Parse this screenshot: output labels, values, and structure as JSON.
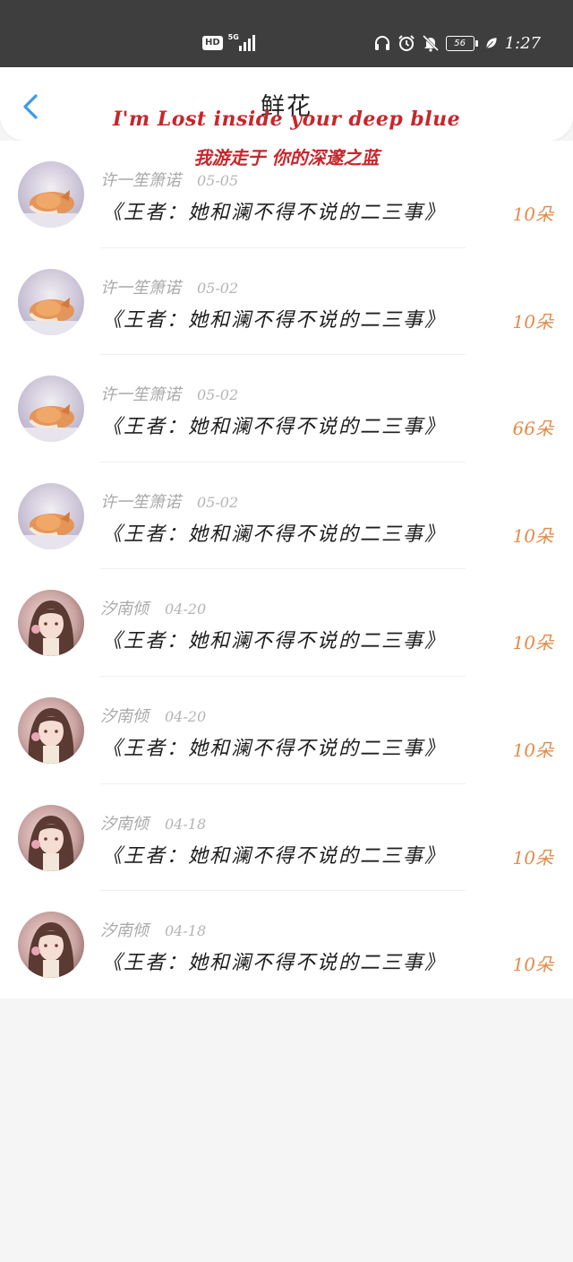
{
  "status_bar": {
    "hd_badge": "HD",
    "network": "5G",
    "battery": "56",
    "time": "1:27",
    "icons": [
      "headphones-icon",
      "alarm-icon",
      "mute-bell-icon",
      "battery-icon",
      "leaf-icon"
    ]
  },
  "header": {
    "title": "鲜花",
    "back_icon": "chevron-left-icon"
  },
  "overlay": {
    "english": "I'm Lost inside your deep blue",
    "chinese": "我游走于 你的深邃之蓝"
  },
  "colors": {
    "accent_blue": "#3a9be8",
    "count_orange": "#e48b4a",
    "overlay_red": "#c8262b"
  },
  "items": [
    {
      "name": "许一笙箫诺",
      "date": "05-05",
      "book": "《王者：她和澜不得不说的二三事》",
      "count": "10朵",
      "avatar": "fox-avatar"
    },
    {
      "name": "许一笙箫诺",
      "date": "05-02",
      "book": "《王者：她和澜不得不说的二三事》",
      "count": "10朵",
      "avatar": "fox-avatar"
    },
    {
      "name": "许一笙箫诺",
      "date": "05-02",
      "book": "《王者：她和澜不得不说的二三事》",
      "count": "66朵",
      "avatar": "fox-avatar"
    },
    {
      "name": "许一笙箫诺",
      "date": "05-02",
      "book": "《王者：她和澜不得不说的二三事》",
      "count": "10朵",
      "avatar": "fox-avatar"
    },
    {
      "name": "汐南倾",
      "date": "04-20",
      "book": "《王者：她和澜不得不说的二三事》",
      "count": "10朵",
      "avatar": "girl-avatar"
    },
    {
      "name": "汐南倾",
      "date": "04-20",
      "book": "《王者：她和澜不得不说的二三事》",
      "count": "10朵",
      "avatar": "girl-avatar"
    },
    {
      "name": "汐南倾",
      "date": "04-18",
      "book": "《王者：她和澜不得不说的二三事》",
      "count": "10朵",
      "avatar": "girl-avatar"
    },
    {
      "name": "汐南倾",
      "date": "04-18",
      "book": "《王者：她和澜不得不说的二三事》",
      "count": "10朵",
      "avatar": "girl-avatar"
    }
  ]
}
